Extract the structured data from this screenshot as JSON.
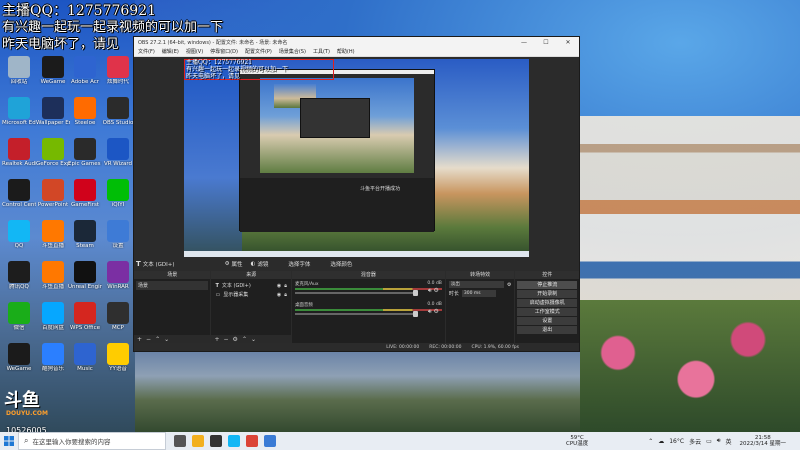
{
  "overlay": {
    "line1": "主播QQ：1275776921",
    "line2": "有兴趣一起玩一起录视频的可以加一下",
    "line3": "昨天电脑坏了，请见"
  },
  "desktop_icons": [
    {
      "label": "回收站",
      "icon": "recycle-bin-icon",
      "color": "#9fb5c8"
    },
    {
      "label": "WeGame",
      "icon": "wegame-icon",
      "color": "#1b1b1b"
    },
    {
      "label": "Adobe Acr",
      "icon": "acrobat-icon",
      "color": "#2e64d0"
    },
    {
      "label": "炫舞时代",
      "icon": "game-icon",
      "color": "#e0334a"
    },
    {
      "label": "Microsoft Edge",
      "icon": "edge-icon",
      "color": "#1fa3d8"
    },
    {
      "label": "Wallpaper Engine",
      "icon": "wallpaper-engine-icon",
      "color": "#1d2f5a"
    },
    {
      "label": "Steeloe",
      "icon": "app-icon",
      "color": "#ff6b00"
    },
    {
      "label": "OBS Studio",
      "icon": "obs-icon",
      "color": "#2b2b2b"
    },
    {
      "label": "Realtek Audio",
      "icon": "realtek-icon",
      "color": "#c41f2a"
    },
    {
      "label": "GeForce Experience",
      "icon": "geforce-icon",
      "color": "#76b900"
    },
    {
      "label": "Epic Games Launcher",
      "icon": "epic-icon",
      "color": "#2a2a2a"
    },
    {
      "label": "VR Wizard",
      "icon": "vr-icon",
      "color": "#1c56c4"
    },
    {
      "label": "Control Center",
      "icon": "control-icon",
      "color": "#1b1b1b"
    },
    {
      "label": "PowerPoint",
      "icon": "powerpoint-icon",
      "color": "#d24726"
    },
    {
      "label": "GameFirst",
      "icon": "gamefirst-icon",
      "color": "#d0021b"
    },
    {
      "label": "iQIYI",
      "icon": "iqiyi-icon",
      "color": "#00be06"
    },
    {
      "label": "QQ",
      "icon": "qq-icon",
      "color": "#12b7f5"
    },
    {
      "label": "斗鱼直播",
      "icon": "douyu-icon",
      "color": "#ff7800"
    },
    {
      "label": "Steam",
      "icon": "steam-icon",
      "color": "#1b2838"
    },
    {
      "label": "设置",
      "icon": "settings-icon",
      "color": "#3e7bd6"
    },
    {
      "label": "腾讯QQ",
      "icon": "qq-icon",
      "color": "#1d1d1d"
    },
    {
      "label": "斗鱼直播",
      "icon": "douyu-icon",
      "color": "#ff7800"
    },
    {
      "label": "Unreal Engine",
      "icon": "unreal-icon",
      "color": "#111111"
    },
    {
      "label": "WinRAR",
      "icon": "winrar-icon",
      "color": "#7b2fa3"
    },
    {
      "label": "微信",
      "icon": "wechat-icon",
      "color": "#1aad19"
    },
    {
      "label": "百度网盘",
      "icon": "baidu-netdisk-icon",
      "color": "#06a7ff"
    },
    {
      "label": "WPS Office",
      "icon": "wps-icon",
      "color": "#d5261f"
    },
    {
      "label": "MCP",
      "icon": "app-icon",
      "color": "#2f2f2f"
    },
    {
      "label": "WeGame",
      "icon": "wegame-icon",
      "color": "#1b1b1b"
    },
    {
      "label": "酷狗音乐",
      "icon": "kugou-icon",
      "color": "#2b7fff"
    },
    {
      "label": "Music",
      "icon": "music-icon",
      "color": "#2e64d0"
    },
    {
      "label": "YY语音",
      "icon": "yy-icon",
      "color": "#ffcc00"
    }
  ],
  "douyu": {
    "logo": "斗鱼",
    "sub": "DOUYU.COM",
    "room": "10526005"
  },
  "obs": {
    "title": "OBS 27.2.1 (64-bit, windows) - 配置文件: 未命名 - 场景: 未命名",
    "menu": [
      "文件(F)",
      "编辑(E)",
      "视图(V)",
      "停靠窗口(D)",
      "配置文件(P)",
      "场景集合(S)",
      "工具(T)",
      "帮助(H)"
    ],
    "preview_text": [
      "主播QQ：1275776921",
      "有兴趣一起玩一起录视频的可以加一下",
      "昨天电脑坏了，请见"
    ],
    "preview_inner_label": "斗鱼平台开播成功",
    "toolbar": {
      "source_name": "文本 (GDI+)",
      "props": "属性",
      "filters": "滤镜",
      "t1": "选择字体",
      "t2": "选择颜色"
    },
    "docks": {
      "scenes": {
        "title": "场景",
        "items": [
          "场景"
        ]
      },
      "sources": {
        "title": "来源",
        "items": [
          {
            "name": "文本 (GDI+)",
            "icon": "text-icon"
          },
          {
            "name": "显示器采集",
            "icon": "monitor-icon"
          }
        ]
      },
      "mixer": {
        "title": "混音器",
        "channels": [
          {
            "name": "麦克风/Aux",
            "level": "0.0 dB"
          },
          {
            "name": "桌面音频",
            "level": "0.0 dB"
          }
        ]
      },
      "transitions": {
        "title": "转场特效",
        "type": "淡出",
        "duration_label": "时长",
        "duration": "300 ms"
      },
      "controls": {
        "title": "控件",
        "buttons": [
          "停止推流",
          "开始录制",
          "启动虚拟摄像机",
          "工作室模式",
          "设置",
          "退出"
        ]
      }
    },
    "status": {
      "live": "LIVE: 00:00:00",
      "rec": "REC: 00:00:00",
      "cpu": "CPU: 1.9%, 60.00 fps"
    }
  },
  "taskbar": {
    "search_placeholder": "在这里输入你要搜索的内容",
    "apps": [
      {
        "icon": "task-view-icon",
        "color": "#555555"
      },
      {
        "icon": "file-explorer-icon",
        "color": "#f2b01e"
      },
      {
        "icon": "obs-icon",
        "color": "#333333"
      },
      {
        "icon": "qq-icon",
        "color": "#12b7f5"
      },
      {
        "icon": "chrome-icon",
        "color": "#db4437"
      },
      {
        "icon": "app-icon",
        "color": "#3a7bd5"
      }
    ],
    "weather": {
      "temp": "59°C",
      "label": "CPU温度"
    },
    "tray": {
      "weather": "16°C",
      "weather_desc": "多云",
      "ime": "英"
    },
    "clock": {
      "time": "21:58",
      "date": "2022/3/14 星期一"
    }
  }
}
